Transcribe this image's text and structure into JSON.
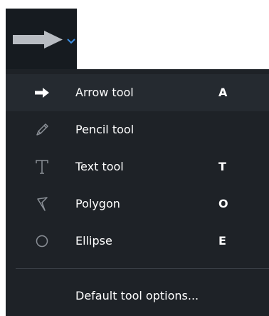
{
  "toolbar": {
    "current_tool_icon": "arrow-icon",
    "dropdown_icon": "chevron-down-icon",
    "accent_color": "#3b8de0"
  },
  "menu": {
    "items": [
      {
        "icon": "arrow-icon",
        "label": "Arrow tool",
        "shortcut": "A",
        "active": true
      },
      {
        "icon": "pencil-icon",
        "label": "Pencil tool",
        "shortcut": ""
      },
      {
        "icon": "text-icon",
        "label": "Text tool",
        "shortcut": "T"
      },
      {
        "icon": "polygon-icon",
        "label": "Polygon",
        "shortcut": "O"
      },
      {
        "icon": "ellipse-icon",
        "label": "Ellipse",
        "shortcut": "E"
      }
    ],
    "footer_item": {
      "label": "Default tool options..."
    }
  },
  "colors": {
    "menu_background": "#1e2227",
    "active_row": "#252a30",
    "toolbar_background": "#161b20",
    "icon_dim": "#8a8f96",
    "text": "#ffffff"
  }
}
